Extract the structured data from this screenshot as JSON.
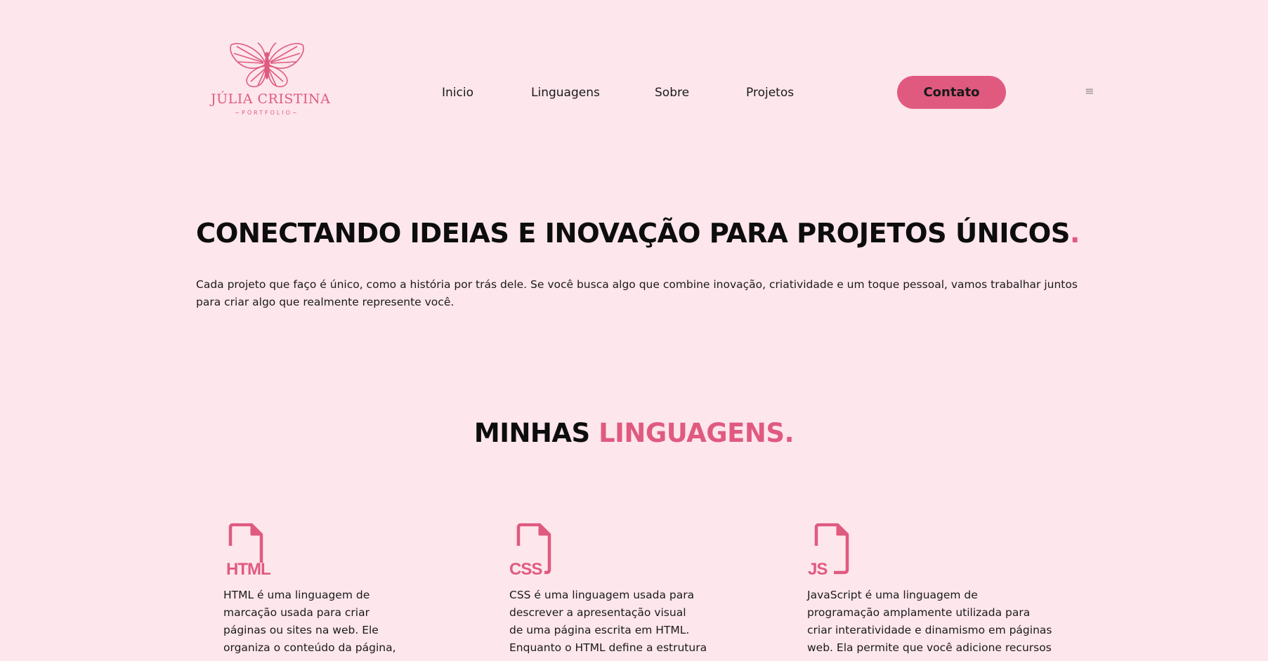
{
  "brand": {
    "name": "JÚLIA CRISTINA",
    "subtitle": "~PÓRTFOLIO~",
    "logo_icon": "butterfly-icon"
  },
  "nav": {
    "items": [
      {
        "label": "Inicio"
      },
      {
        "label": "Linguagens"
      },
      {
        "label": "Sobre"
      },
      {
        "label": "Projetos"
      }
    ],
    "contact_label": "Contato",
    "menu_icon": "≡"
  },
  "hero": {
    "title": "CONECTANDO IDEIAS E INOVAÇÃO PARA PROJETOS ÚNICOS",
    "title_dot": ".",
    "description": "Cada projeto que faço é único, como a história por trás dele. Se você busca algo que combine inovação, criatividade e um toque pessoal, vamos trabalhar juntos para criar algo que realmente represente você."
  },
  "languages": {
    "title_prefix": "MINHAS ",
    "title_accent": "LINGUAGENS.",
    "cards": [
      {
        "icon_label": "HTML",
        "icon": "html-file-icon",
        "lines": [
          "HTML é uma linguagem de",
          "marcação usada para criar",
          "páginas ou sites na web. Ele",
          "organiza o conteúdo da página,"
        ]
      },
      {
        "icon_label": "CSS",
        "icon": "css-file-icon",
        "lines": [
          "CSS é uma linguagem usada para",
          "descrever a apresentação visual",
          "de uma página escrita em HTML.",
          "Enquanto o HTML define a estrutura"
        ]
      },
      {
        "icon_label": "JS",
        "icon": "js-file-icon",
        "lines": [
          "JavaScript é uma linguagem de",
          "programação amplamente utilizada para",
          "criar interatividade e dinamismo em páginas",
          "web. Ela permite que você adicione recursos"
        ]
      }
    ]
  },
  "colors": {
    "background": "#fde6ec",
    "accent": "#e05a80",
    "text": "#1a1a1a"
  }
}
